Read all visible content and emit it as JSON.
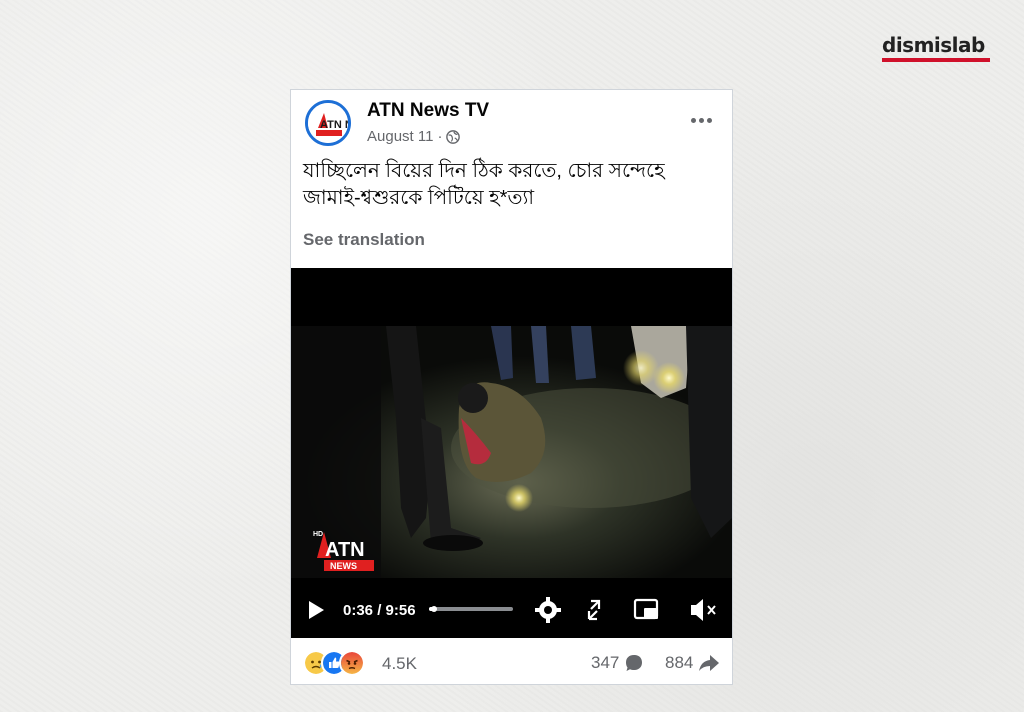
{
  "watermark": {
    "brand": "dismislab",
    "accent_color": "#d0112b"
  },
  "post": {
    "page_name": "ATN News TV",
    "avatar_logo": "ATN NEWS",
    "date": "August 11",
    "date_separator": "·",
    "visibility_icon": "globe-icon",
    "more_icon": "more-dots-icon",
    "caption_line1": "যাচ্ছিলেন বিয়ের দিন ঠিক করতে, চোর সন্দেহে",
    "caption_line2": "জামাই-শ্বশুরকে পিটিয়ে হ*ত্যা",
    "see_translation": "See translation"
  },
  "video": {
    "overlay_logo_prefix": "HD",
    "overlay_logo_text": "ATN",
    "overlay_logo_sub": "NEWS",
    "current_time": "0:36",
    "duration": "9:56",
    "time_display": "0:36 / 9:56",
    "progress": 0.06,
    "controls": [
      "play-icon",
      "settings-gear-icon",
      "fullscreen-icon",
      "picture-in-picture-icon",
      "mute-icon"
    ]
  },
  "engagement": {
    "reactions": [
      "sad",
      "like",
      "angry"
    ],
    "reaction_count": "4.5K",
    "comment_count": "347",
    "share_count": "884"
  }
}
